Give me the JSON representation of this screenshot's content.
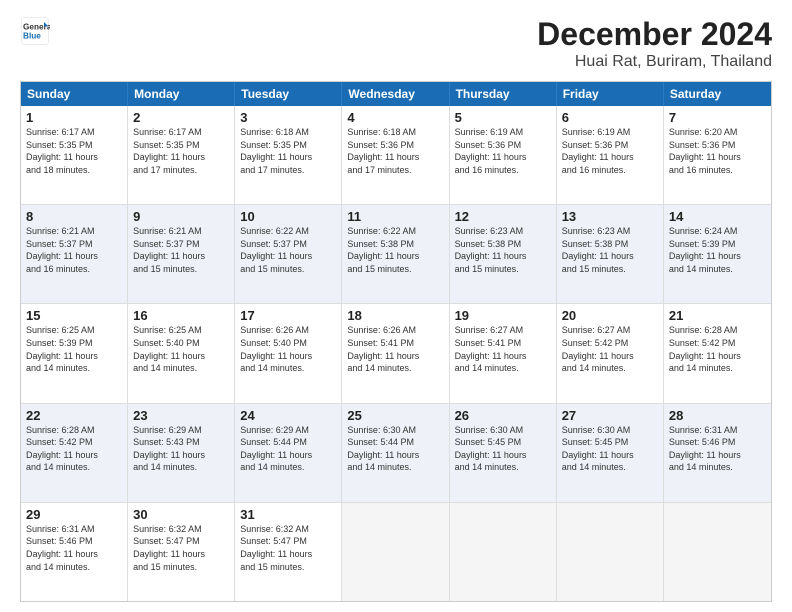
{
  "logo": {
    "line1": "General",
    "line2": "Blue"
  },
  "title": "December 2024",
  "subtitle": "Huai Rat, Buriram, Thailand",
  "weekdays": [
    "Sunday",
    "Monday",
    "Tuesday",
    "Wednesday",
    "Thursday",
    "Friday",
    "Saturday"
  ],
  "weeks": [
    [
      {
        "day": 1,
        "sunrise": "6:17 AM",
        "sunset": "5:35 PM",
        "daylight": "11 hours and 18 minutes."
      },
      {
        "day": 2,
        "sunrise": "6:17 AM",
        "sunset": "5:35 PM",
        "daylight": "11 hours and 17 minutes."
      },
      {
        "day": 3,
        "sunrise": "6:18 AM",
        "sunset": "5:35 PM",
        "daylight": "11 hours and 17 minutes."
      },
      {
        "day": 4,
        "sunrise": "6:18 AM",
        "sunset": "5:36 PM",
        "daylight": "11 hours and 17 minutes."
      },
      {
        "day": 5,
        "sunrise": "6:19 AM",
        "sunset": "5:36 PM",
        "daylight": "11 hours and 16 minutes."
      },
      {
        "day": 6,
        "sunrise": "6:19 AM",
        "sunset": "5:36 PM",
        "daylight": "11 hours and 16 minutes."
      },
      {
        "day": 7,
        "sunrise": "6:20 AM",
        "sunset": "5:36 PM",
        "daylight": "11 hours and 16 minutes."
      }
    ],
    [
      {
        "day": 8,
        "sunrise": "6:21 AM",
        "sunset": "5:37 PM",
        "daylight": "11 hours and 16 minutes."
      },
      {
        "day": 9,
        "sunrise": "6:21 AM",
        "sunset": "5:37 PM",
        "daylight": "11 hours and 15 minutes."
      },
      {
        "day": 10,
        "sunrise": "6:22 AM",
        "sunset": "5:37 PM",
        "daylight": "11 hours and 15 minutes."
      },
      {
        "day": 11,
        "sunrise": "6:22 AM",
        "sunset": "5:38 PM",
        "daylight": "11 hours and 15 minutes."
      },
      {
        "day": 12,
        "sunrise": "6:23 AM",
        "sunset": "5:38 PM",
        "daylight": "11 hours and 15 minutes."
      },
      {
        "day": 13,
        "sunrise": "6:23 AM",
        "sunset": "5:38 PM",
        "daylight": "11 hours and 15 minutes."
      },
      {
        "day": 14,
        "sunrise": "6:24 AM",
        "sunset": "5:39 PM",
        "daylight": "11 hours and 14 minutes."
      }
    ],
    [
      {
        "day": 15,
        "sunrise": "6:25 AM",
        "sunset": "5:39 PM",
        "daylight": "11 hours and 14 minutes."
      },
      {
        "day": 16,
        "sunrise": "6:25 AM",
        "sunset": "5:40 PM",
        "daylight": "11 hours and 14 minutes."
      },
      {
        "day": 17,
        "sunrise": "6:26 AM",
        "sunset": "5:40 PM",
        "daylight": "11 hours and 14 minutes."
      },
      {
        "day": 18,
        "sunrise": "6:26 AM",
        "sunset": "5:41 PM",
        "daylight": "11 hours and 14 minutes."
      },
      {
        "day": 19,
        "sunrise": "6:27 AM",
        "sunset": "5:41 PM",
        "daylight": "11 hours and 14 minutes."
      },
      {
        "day": 20,
        "sunrise": "6:27 AM",
        "sunset": "5:42 PM",
        "daylight": "11 hours and 14 minutes."
      },
      {
        "day": 21,
        "sunrise": "6:28 AM",
        "sunset": "5:42 PM",
        "daylight": "11 hours and 14 minutes."
      }
    ],
    [
      {
        "day": 22,
        "sunrise": "6:28 AM",
        "sunset": "5:42 PM",
        "daylight": "11 hours and 14 minutes."
      },
      {
        "day": 23,
        "sunrise": "6:29 AM",
        "sunset": "5:43 PM",
        "daylight": "11 hours and 14 minutes."
      },
      {
        "day": 24,
        "sunrise": "6:29 AM",
        "sunset": "5:44 PM",
        "daylight": "11 hours and 14 minutes."
      },
      {
        "day": 25,
        "sunrise": "6:30 AM",
        "sunset": "5:44 PM",
        "daylight": "11 hours and 14 minutes."
      },
      {
        "day": 26,
        "sunrise": "6:30 AM",
        "sunset": "5:45 PM",
        "daylight": "11 hours and 14 minutes."
      },
      {
        "day": 27,
        "sunrise": "6:30 AM",
        "sunset": "5:45 PM",
        "daylight": "11 hours and 14 minutes."
      },
      {
        "day": 28,
        "sunrise": "6:31 AM",
        "sunset": "5:46 PM",
        "daylight": "11 hours and 14 minutes."
      }
    ],
    [
      {
        "day": 29,
        "sunrise": "6:31 AM",
        "sunset": "5:46 PM",
        "daylight": "11 hours and 14 minutes."
      },
      {
        "day": 30,
        "sunrise": "6:32 AM",
        "sunset": "5:47 PM",
        "daylight": "11 hours and 15 minutes."
      },
      {
        "day": 31,
        "sunrise": "6:32 AM",
        "sunset": "5:47 PM",
        "daylight": "11 hours and 15 minutes."
      },
      null,
      null,
      null,
      null
    ]
  ]
}
